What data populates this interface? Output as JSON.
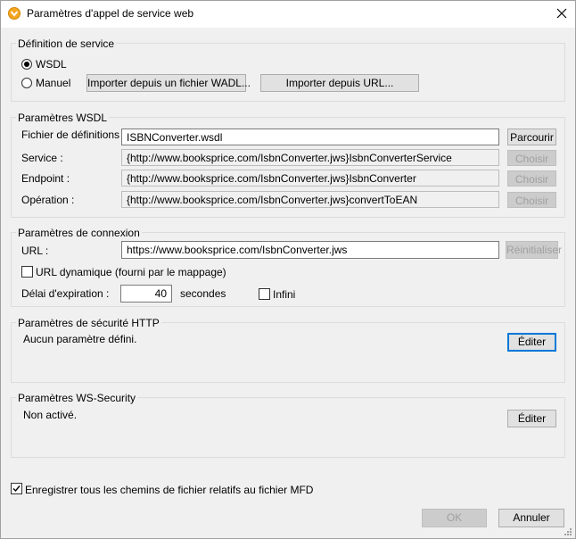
{
  "window": {
    "title": "Paramètres d'appel de service web"
  },
  "service_definition": {
    "title": "Définition de service",
    "wsdl_label": "WSDL",
    "manual_label": "Manuel",
    "import_wadl_button": "Importer depuis un fichier WADL...",
    "import_url_button": "Importer depuis URL..."
  },
  "wsdl_params": {
    "title": "Paramètres WSDL",
    "definitions_label": "Fichier de définitions :",
    "definitions_value": "ISBNConverter.wsdl",
    "browse_button": "Parcourir",
    "service_label": "Service :",
    "service_value": "{http://www.booksprice.com/IsbnConverter.jws}IsbnConverterService",
    "endpoint_label": "Endpoint :",
    "endpoint_value": "{http://www.booksprice.com/IsbnConverter.jws}IsbnConverter",
    "operation_label": "Opération :",
    "operation_value": "{http://www.booksprice.com/IsbnConverter.jws}convertToEAN",
    "choose_button": "Choisir"
  },
  "connection": {
    "title": "Paramètres de connexion",
    "url_label": "URL :",
    "url_value": "https://www.booksprice.com/IsbnConverter.jws",
    "reset_button": "Réinitialiser",
    "dynamic_url_label": "URL dynamique (fourni par le mappage)",
    "timeout_label": "Délai d'expiration :",
    "timeout_value": "40",
    "seconds_label": "secondes",
    "infinite_label": "Infini"
  },
  "http_security": {
    "title": "Paramètres de sécurité HTTP",
    "status": "Aucun paramètre défini.",
    "edit_button": "Éditer"
  },
  "ws_security": {
    "title": "Paramètres WS-Security",
    "status": "Non activé.",
    "edit_button": "Éditer"
  },
  "footer": {
    "save_relative_label": "Enregistrer tous les chemins de fichier relatifs au fichier MFD",
    "ok_button": "OK",
    "cancel_button": "Annuler"
  },
  "colors": {
    "focus": "#0078d7",
    "app_icon": "#f5a623"
  }
}
